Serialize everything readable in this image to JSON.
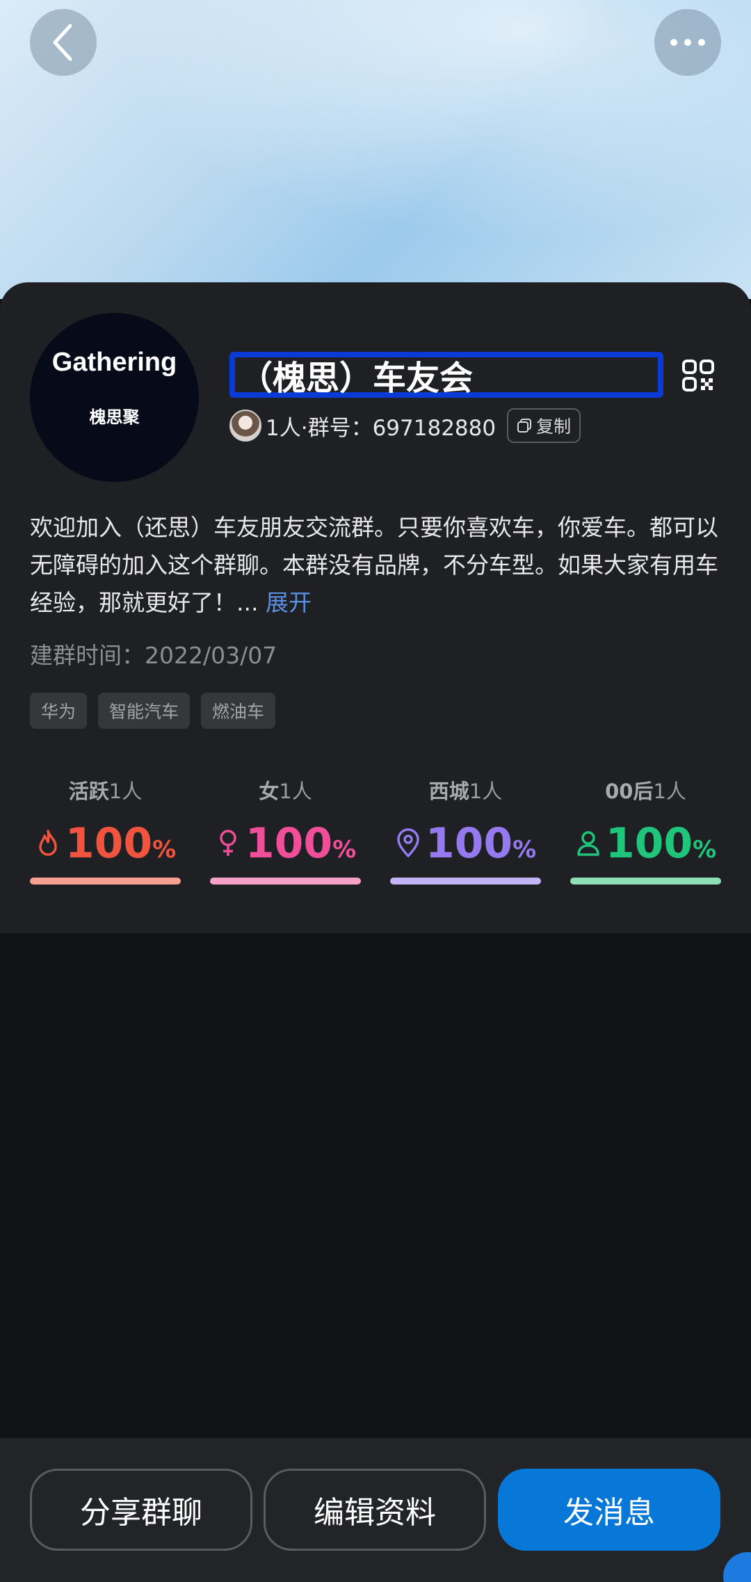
{
  "header": {
    "back_icon": "chevron-left-icon",
    "more_icon": "more-horizontal-icon"
  },
  "group": {
    "avatar_title": "Gathering",
    "avatar_subtitle": "槐思聚",
    "name": "（槐思）车友会",
    "member_count_and_id": "1人·群号：697182880",
    "copy_label": "复制",
    "description": "欢迎加入（还思）车友朋友交流群。只要你喜欢车，你爱车。都可以无障碍的加入这个群聊。本群没有品牌，不分车型。如果大家有用车经验，那就更好了！...",
    "expand_label": "展开",
    "created": "建群时间：2022/03/07",
    "tags": [
      "华为",
      "智能汽车",
      "燃油车"
    ]
  },
  "stats": [
    {
      "label": "活跃",
      "count": "1人",
      "value": "100",
      "unit": "%",
      "icon": "flame-icon",
      "color": "#f0533e",
      "bar_color": "#f8a08f"
    },
    {
      "label": "女",
      "count": "1人",
      "value": "100",
      "unit": "%",
      "icon": "female-icon",
      "color": "#ef4e99",
      "bar_color": "#f6a1c8"
    },
    {
      "label": "西城",
      "count": "1人",
      "value": "100",
      "unit": "%",
      "icon": "location-pin-icon",
      "color": "#9479f0",
      "bar_color": "#c3b4f6"
    },
    {
      "label": "00后",
      "count": "1人",
      "value": "100",
      "unit": "%",
      "icon": "person-icon",
      "color": "#1fc57a",
      "bar_color": "#8fdfb6"
    }
  ],
  "actions": {
    "share_label": "分享群聊",
    "edit_label": "编辑资料",
    "message_label": "发消息"
  },
  "colors": {
    "primary": "#0878d8",
    "highlight_box": "#0a3bd6"
  }
}
